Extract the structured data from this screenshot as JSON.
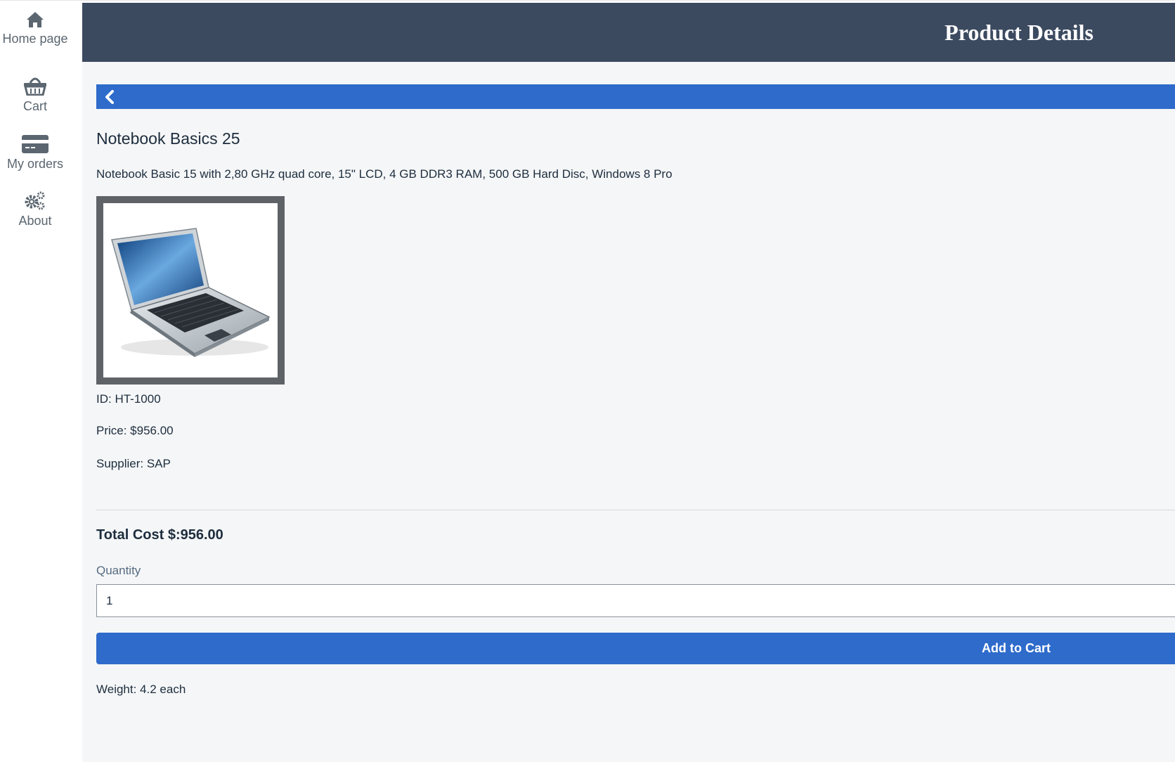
{
  "sidebar": {
    "items": [
      {
        "id": "home",
        "icon": "home-icon",
        "label": "Home page"
      },
      {
        "id": "cart",
        "icon": "basket-icon",
        "label": "Cart"
      },
      {
        "id": "orders",
        "icon": "credit-card-icon",
        "label": "My orders"
      },
      {
        "id": "about",
        "icon": "gears-icon",
        "label": "About"
      }
    ]
  },
  "header": {
    "title": "Product Details"
  },
  "navbar": {
    "back_icon": "chevron-left-icon",
    "color": "#2e6bcb"
  },
  "product": {
    "title": "Notebook Basics 25",
    "description": "Notebook Basic 15 with 2,80 GHz quad core, 15\" LCD, 4 GB DDR3 RAM, 500 GB Hard Disc, Windows 8 Pro",
    "image_icon": "laptop-icon",
    "id_line": "ID: HT-1000",
    "price_line": "Price: $956.00",
    "supplier_line": "Supplier: SAP",
    "total_line": "Total Cost $:956.00",
    "weight_line": "Weight: 4.2 each"
  },
  "quantity": {
    "label": "Quantity",
    "value": "1"
  },
  "add_to_cart": {
    "label": "Add to Cart"
  },
  "colors": {
    "header_bg": "#3c4a60",
    "accent": "#2e6bcb"
  }
}
